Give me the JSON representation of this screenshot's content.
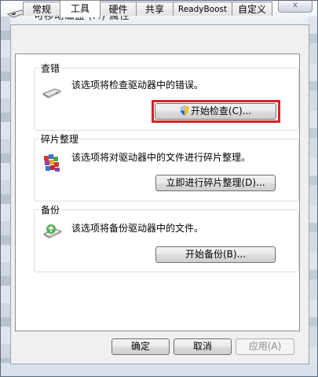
{
  "window": {
    "title": "可移动磁盘 (F:) 属性",
    "close_label": "x",
    "icon": "removable-drive-icon"
  },
  "tabs": [
    {
      "label": "常规",
      "active": false
    },
    {
      "label": "工具",
      "active": true
    },
    {
      "label": "硬件",
      "active": false
    },
    {
      "label": "共享",
      "active": false
    },
    {
      "label": "ReadyBoost",
      "active": false
    },
    {
      "label": "自定义",
      "active": false
    }
  ],
  "groups": {
    "error_check": {
      "title": "查错",
      "description": "该选项将检查驱动器中的错误。",
      "button": "开始检查(C)...",
      "icon": "drive-check-icon",
      "button_icon": "uac-shield-icon"
    },
    "defrag": {
      "title": "碎片整理",
      "description": "该选项将对驱动器中的文件进行碎片整理。",
      "button": "立即进行碎片整理(D)...",
      "icon": "defragment-icon"
    },
    "backup": {
      "title": "备份",
      "description": "该选项将备份驱动器中的文件。",
      "button": "开始备份(B)...",
      "icon": "backup-icon"
    }
  },
  "footer": {
    "ok": "确定",
    "cancel": "取消",
    "apply": "应用(A)"
  },
  "colors": {
    "highlight_border": "#d2232a",
    "panel_border": "#8e8f8f"
  }
}
